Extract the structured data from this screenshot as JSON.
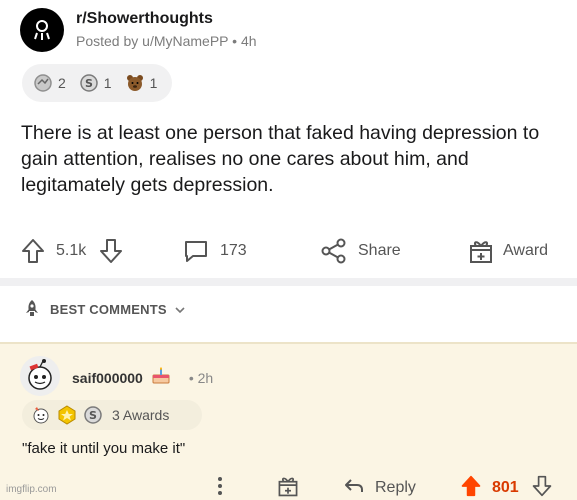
{
  "post": {
    "subreddit": "r/Showerthoughts",
    "posted_by": "Posted by u/MyNamePP • 4h",
    "awards": [
      {
        "icon": "silver-award-icon",
        "count": "2"
      },
      {
        "icon": "helpful-award-icon",
        "count": "1"
      },
      {
        "icon": "bear-award-icon",
        "count": "1"
      }
    ],
    "title": "There is at least one person that faked having depression to gain attention, realises no one cares about him, and legitamately gets depression.",
    "actions": {
      "upvotes": "5.1k",
      "comments": "173",
      "share": "Share",
      "award": "Award"
    }
  },
  "best_comments_label": "BEST COMMENTS",
  "comment": {
    "username": "saif000000",
    "time": "• 2h",
    "awards_label": "3 Awards",
    "body": "\"fake it until you make it\"",
    "reply": "Reply",
    "score": "801"
  },
  "watermark": "imgflip.com",
  "colors": {
    "upvote_active": "#ff4500",
    "comment_bg": "#fbf5e4",
    "muted_text": "#7c7c7c"
  }
}
